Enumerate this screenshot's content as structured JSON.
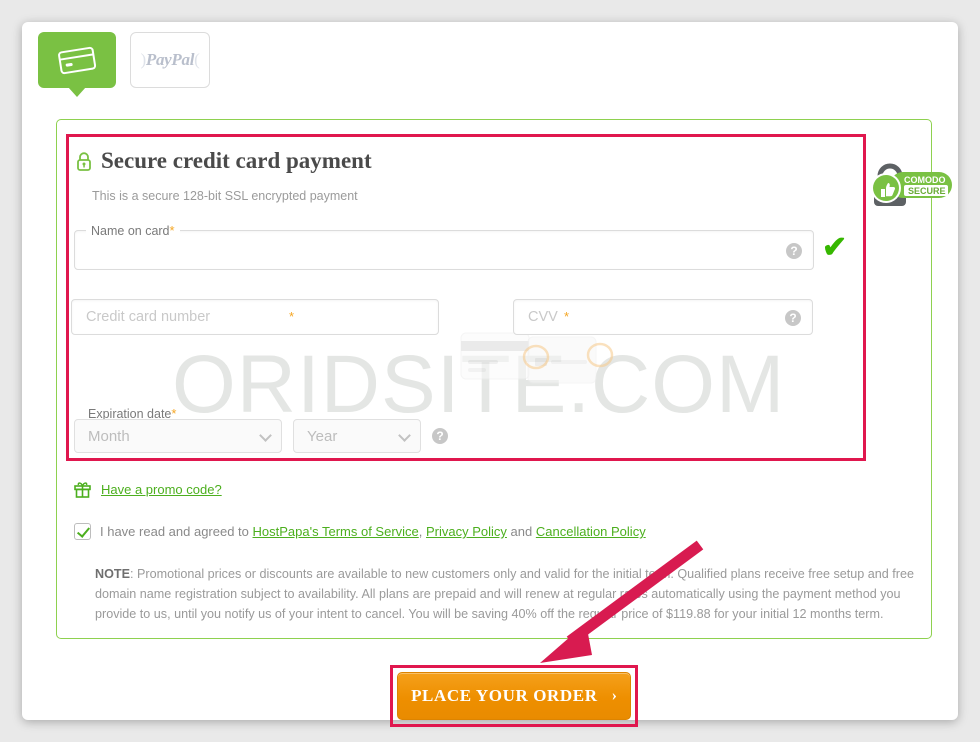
{
  "tabs": [
    {
      "id": "credit-card",
      "label": "Credit card",
      "icon": "credit-card-icon",
      "active": true
    },
    {
      "id": "paypal",
      "label": "PayPal",
      "icon": "paypal-logo",
      "active": false
    }
  ],
  "watermark": "ORIDSITE.COM",
  "section": {
    "icon": "lock-icon",
    "title": "Secure credit card payment",
    "subtitle": "This is a secure 128-bit SSL encrypted payment"
  },
  "badge": {
    "name": "comodo-secure-badge",
    "line1": "COMODO",
    "line2": "SECURE"
  },
  "fields": {
    "name_on_card": {
      "label": "Name on card",
      "required_mark": "*",
      "value": "",
      "placeholder": "",
      "help": "?",
      "valid_mark": "✔"
    },
    "card_number": {
      "label": "",
      "placeholder": "Credit card number",
      "required_mark": "*",
      "value": ""
    },
    "cvv": {
      "label": "",
      "placeholder": "CVV",
      "required_mark": "*",
      "value": "",
      "help": "?"
    },
    "expiration": {
      "label": "Expiration date",
      "required_mark": "*",
      "month": {
        "selected": "Month"
      },
      "year": {
        "selected": "Year"
      },
      "help": "?"
    }
  },
  "promo": {
    "icon": "gift-icon",
    "link": "Have a promo code?"
  },
  "terms": {
    "checked": true,
    "prefix": "I have read and agreed to ",
    "links": [
      {
        "text": "HostPapa's Terms of Service"
      },
      {
        "text": "Privacy Policy"
      },
      {
        "text": "Cancellation Policy"
      }
    ],
    "sep1": ", ",
    "sep2": " and "
  },
  "note": {
    "label": "NOTE",
    "text": ": Promotional prices or discounts are available to new customers only and valid for the initial term. Qualified plans receive free setup and free domain name registration subject to availability. All plans are prepaid and will renew at regular rates automatically using the payment method you provide to us, until you notify us of your intent to cancel. You will be saving 40% off the regular price of $119.88 for your initial 12 months term."
  },
  "order_button": {
    "label": "PLACE YOUR ORDER",
    "arrow": "›"
  },
  "annotations": {
    "highlight_color": "#e0174e",
    "arrow_color": "#d81b50"
  },
  "colors": {
    "brand_green": "#7ac143",
    "link_green": "#4caf1e",
    "order_orange": "#ee8f00",
    "required_orange": "#f5a623"
  }
}
